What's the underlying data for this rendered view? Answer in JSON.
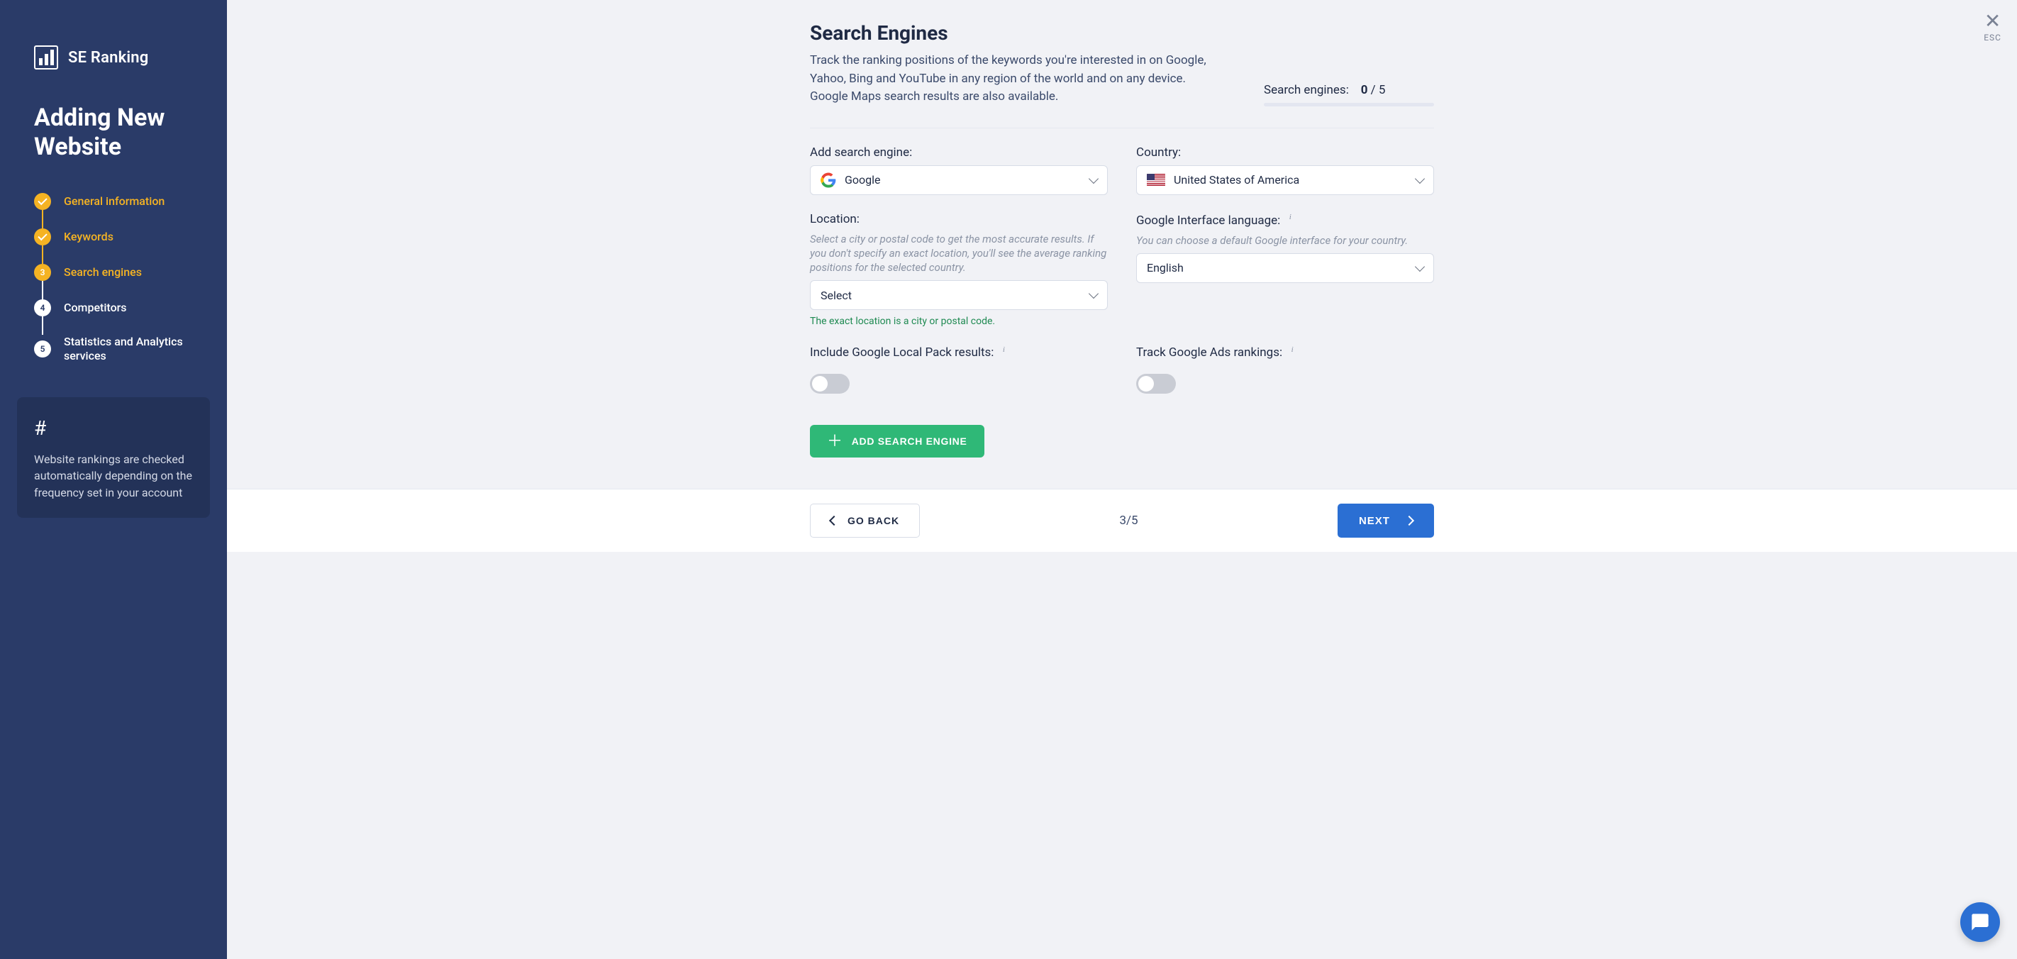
{
  "brand": {
    "name": "SE Ranking"
  },
  "sidebar": {
    "title": "Adding New Website",
    "steps": [
      {
        "label": "General information",
        "state": "done",
        "marker": "check"
      },
      {
        "label": "Keywords",
        "state": "done",
        "marker": "check"
      },
      {
        "label": "Search engines",
        "state": "active",
        "marker": "3"
      },
      {
        "label": "Competitors",
        "state": "pending",
        "marker": "4"
      },
      {
        "label": "Statistics and Analytics services",
        "state": "pending",
        "marker": "5"
      }
    ],
    "tip": {
      "icon": "#",
      "text": "Website rankings are checked automatically depending on the frequency set in your account"
    }
  },
  "close": {
    "label": "ESC"
  },
  "page": {
    "title": "Search Engines",
    "subtitle": "Track the ranking positions of the keywords you're interested in on Google, Yahoo, Bing and YouTube in any region of the world and on any device. Google Maps search results are also available.",
    "counter": {
      "label": "Search engines:",
      "current": "0",
      "sep": " / ",
      "max": "5"
    }
  },
  "form": {
    "searchEngine": {
      "label": "Add search engine:",
      "value": "Google"
    },
    "country": {
      "label": "Country:",
      "value": "United States of America"
    },
    "location": {
      "label": "Location:",
      "hint": "Select a city or postal code to get the most accurate results. If you don't specify an exact location, you'll see the average ranking positions for the selected country.",
      "value": "Select",
      "note": "The exact location is a city or postal code."
    },
    "interfaceLang": {
      "label": "Google Interface language:",
      "hint": "You can choose a default Google interface for your country.",
      "value": "English"
    },
    "localPack": {
      "label": "Include Google Local Pack results:",
      "on": false
    },
    "adsRanking": {
      "label": "Track Google Ads rankings:",
      "on": false
    },
    "addButton": "ADD SEARCH ENGINE"
  },
  "footer": {
    "back": "GO BACK",
    "pager": "3/5",
    "next": "NEXT"
  }
}
